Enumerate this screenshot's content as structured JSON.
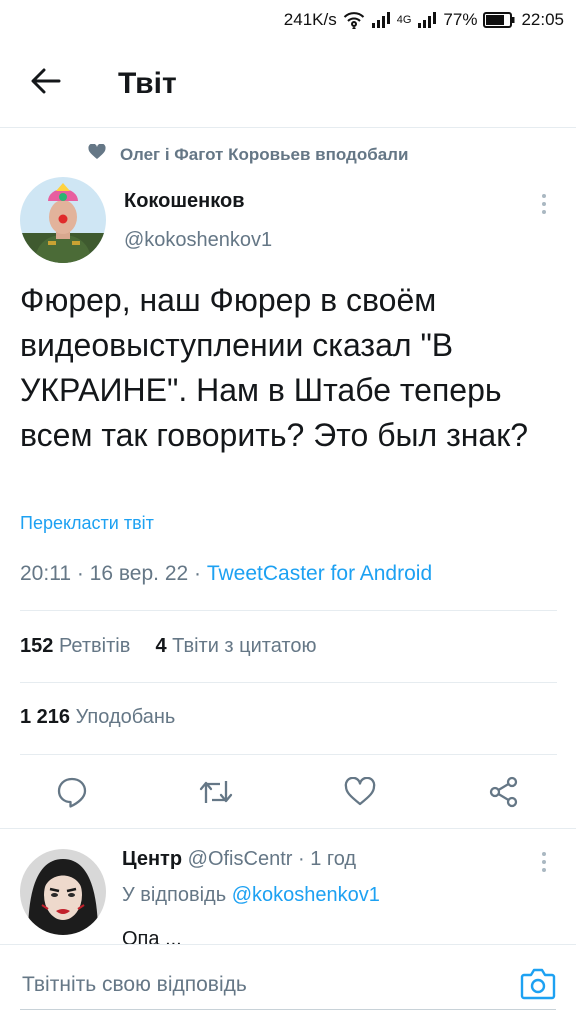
{
  "status_bar": {
    "speed": "241K/s",
    "network": "4G",
    "battery": "77%",
    "time": "22:05"
  },
  "header": {
    "title": "Твіт"
  },
  "social_context": {
    "text": "Олег і Фагот Коровьев вподобали"
  },
  "tweet": {
    "author_name": "Кокошенков",
    "author_handle": "@kokoshenkov1",
    "text": "Фюрер, наш Фюрер в своём видеовыступлении сказал \"В УКРАИНЕ\". Нам в Штабе теперь всем так говорить? Это был знак?",
    "translate_label": "Перекласти твіт",
    "time": "20:11",
    "date": "16 вер. 22",
    "client": "TweetCaster for Android",
    "retweets_count": "152",
    "retweets_label": "Ретвітів",
    "quotes_count": "4",
    "quotes_label": "Твіти з цитатою",
    "likes_count": "1 216",
    "likes_label": "Уподобань"
  },
  "reply": {
    "author_name": "Центр",
    "author_handle": "@OfisCentr",
    "age": "1 год",
    "reply_to_prefix": "У відповідь",
    "reply_to_handle": "@kokoshenkov1",
    "text": "Опа ..."
  },
  "compose": {
    "placeholder": "Твітніть свою відповідь"
  },
  "colors": {
    "accent": "#1da1f2",
    "secondary_text": "#657786",
    "primary_text": "#14171a",
    "divider": "#e6ecf0"
  },
  "icons": [
    "back-arrow-icon",
    "heart-icon",
    "more-vertical-icon",
    "reply-icon",
    "retweet-icon",
    "like-icon",
    "share-icon",
    "camera-icon",
    "wifi-icon",
    "signal-icon",
    "battery-icon"
  ]
}
